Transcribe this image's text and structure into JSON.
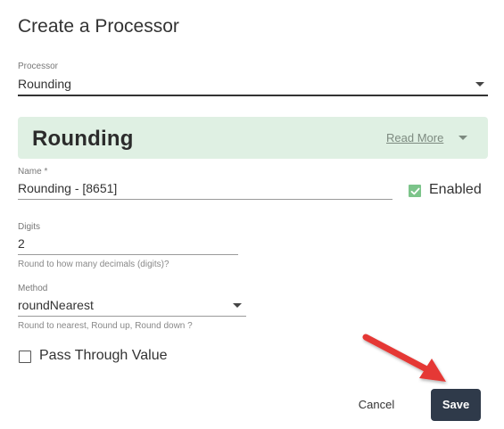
{
  "dialog": {
    "title": "Create a Processor"
  },
  "processor": {
    "label": "Processor",
    "value": "Rounding"
  },
  "banner": {
    "title": "Rounding",
    "read_more": "Read More",
    "color": "#dff0e3"
  },
  "name": {
    "label": "Name *",
    "value": "Rounding  - [8651]"
  },
  "enabled": {
    "label": "Enabled",
    "checked": true,
    "color": "#7cc48a"
  },
  "digits": {
    "label": "Digits",
    "value": "2",
    "hint": "Round to how many decimals (digits)?"
  },
  "method": {
    "label": "Method",
    "value": "roundNearest",
    "hint": "Round to nearest, Round up, Round down ?"
  },
  "pass_through": {
    "label": "Pass Through Value",
    "checked": false
  },
  "buttons": {
    "cancel": "Cancel",
    "save": "Save",
    "save_color": "#2f3a4a"
  },
  "annotation": {
    "arrow_color": "#e53935"
  },
  "icons": [
    "chevron-down-icon",
    "check-icon",
    "arrow-pointer-icon"
  ]
}
